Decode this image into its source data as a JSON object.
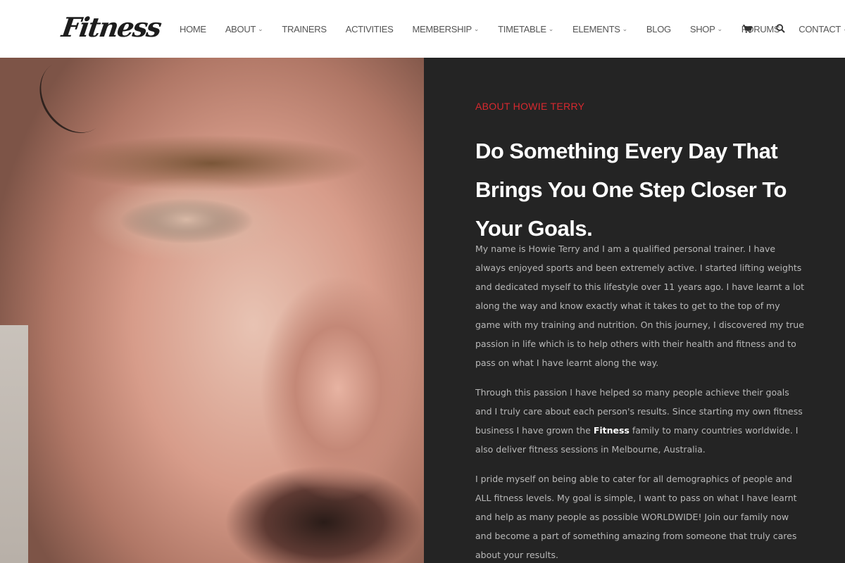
{
  "header": {
    "logo": "Fitness",
    "nav": [
      {
        "label": "HOME",
        "has_dropdown": false
      },
      {
        "label": "ABOUT",
        "has_dropdown": true
      },
      {
        "label": "TRAINERS",
        "has_dropdown": false
      },
      {
        "label": "ACTIVITIES",
        "has_dropdown": false
      },
      {
        "label": "MEMBERSHIP",
        "has_dropdown": true
      },
      {
        "label": "TIMETABLE",
        "has_dropdown": true
      },
      {
        "label": "ELEMENTS",
        "has_dropdown": true
      },
      {
        "label": "BLOG",
        "has_dropdown": false
      },
      {
        "label": "SHOP",
        "has_dropdown": true
      },
      {
        "label": "FORUMS",
        "has_dropdown": false
      },
      {
        "label": "CONTACT",
        "has_dropdown": true
      }
    ],
    "icons": {
      "cart": "cart-icon",
      "search": "search-icon"
    }
  },
  "content": {
    "eyebrow": "ABOUT HOWIE TERRY",
    "headline": "Do Something Every Day That Brings You One Step Closer To Your Goals.",
    "paragraph1": "My name is Howie Terry and I am a qualified personal trainer. I have always enjoyed sports and been extremely active. I started lifting weights and dedicated myself to this lifestyle over 11 years ago. I have learnt a lot along the way and know exactly what it takes to get to the top of my game with my training and nutrition. On this journey, I discovered my true passion in life which is to help others with their health and fitness and to pass on what I have learnt along the way.",
    "paragraph2_before": "Through this passion I have helped so many people achieve their goals and I truly care about each person's results. Since starting my own fitness business I have grown the ",
    "paragraph2_brand": "Fitness",
    "paragraph2_after": " family to many countries worldwide. I also deliver fitness sessions in Melbourne, Australia.",
    "paragraph3": "I pride myself on being able to cater for all demographics of people and ALL fitness levels. My goal is simple, I want to pass on what I have learnt and help as many people as possible WORLDWIDE! Join our family now and become a part of something amazing from someone that truly cares about your results."
  },
  "colors": {
    "accent": "#d8292f",
    "panel_bg": "#242424",
    "header_bg": "#ffffff",
    "body_text": "#b8b8b8",
    "headline": "#ffffff"
  }
}
